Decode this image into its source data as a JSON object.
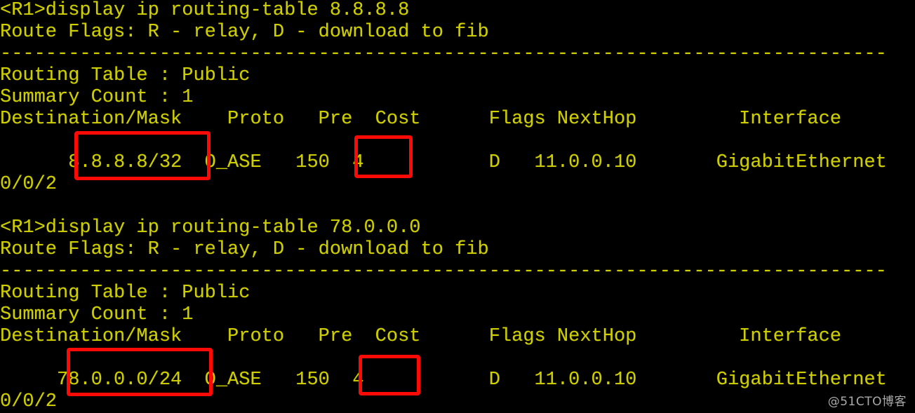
{
  "terminal": {
    "background_color": "#000000",
    "text_color": "#cfcf00",
    "highlight_color": "#fb0a06",
    "watermark": "@51CTO博客",
    "lines": [
      "<R1>display ip routing-table 8.8.8.8",
      "Route Flags: R - relay, D - download to fib",
      "------------------------------------------------------------------------------",
      "Routing Table : Public",
      "Summary Count : 1",
      "Destination/Mask    Proto   Pre  Cost      Flags NextHop         Interface",
      "",
      "      8.8.8.8/32  O_ASE   150  4           D   11.0.0.10       GigabitEthernet",
      "0/0/2",
      "",
      "<R1>display ip routing-table 78.0.0.0",
      "Route Flags: R - relay, D - download to fib",
      "------------------------------------------------------------------------------",
      "Routing Table : Public",
      "Summary Count : 1",
      "Destination/Mask    Proto   Pre  Cost      Flags NextHop         Interface",
      "",
      "     78.0.0.0/24  O_ASE   150  4           D   11.0.0.10       GigabitEthernet",
      "0/0/2"
    ],
    "sessions": [
      {
        "prompt": "<R1>",
        "command": "display ip routing-table 8.8.8.8",
        "route_flags": "Route Flags: R - relay, D - download to fib",
        "separator": "------------------------------------------------------------------------------",
        "routing_table": "Routing Table : Public",
        "summary_count": "Summary Count : 1",
        "columns": [
          "Destination/Mask",
          "Proto",
          "Pre",
          "Cost",
          "Flags",
          "NextHop",
          "Interface"
        ],
        "rows": [
          {
            "destination_mask": "8.8.8.8/32",
            "proto": "O_ASE",
            "pre": "150",
            "cost": "4",
            "flags": "D",
            "nexthop": "11.0.0.10",
            "interface": "GigabitEthernet",
            "interface_wrap": "0/0/2"
          }
        ],
        "highlighted": [
          "destination_mask",
          "cost"
        ]
      },
      {
        "prompt": "<R1>",
        "command": "display ip routing-table 78.0.0.0",
        "route_flags": "Route Flags: R - relay, D - download to fib",
        "separator": "------------------------------------------------------------------------------",
        "routing_table": "Routing Table : Public",
        "summary_count": "Summary Count : 1",
        "columns": [
          "Destination/Mask",
          "Proto",
          "Pre",
          "Cost",
          "Flags",
          "NextHop",
          "Interface"
        ],
        "rows": [
          {
            "destination_mask": "78.0.0.0/24",
            "proto": "O_ASE",
            "pre": "150",
            "cost": "4",
            "flags": "D",
            "nexthop": "11.0.0.10",
            "interface": "GigabitEthernet",
            "interface_wrap": "0/0/2"
          }
        ],
        "highlighted": [
          "destination_mask",
          "cost"
        ]
      }
    ]
  }
}
